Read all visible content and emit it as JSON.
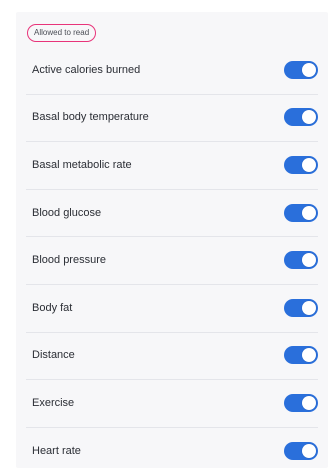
{
  "section": {
    "label": "Allowed to read"
  },
  "colors": {
    "accent": "#2a6fdb",
    "highlight_outline": "#e8347a",
    "panel_background": "#f7f7f9"
  },
  "permissions": [
    {
      "label": "Active calories burned",
      "enabled": true
    },
    {
      "label": "Basal body temperature",
      "enabled": true
    },
    {
      "label": "Basal metabolic rate",
      "enabled": true
    },
    {
      "label": "Blood glucose",
      "enabled": true
    },
    {
      "label": "Blood pressure",
      "enabled": true
    },
    {
      "label": "Body fat",
      "enabled": true
    },
    {
      "label": "Distance",
      "enabled": true
    },
    {
      "label": "Exercise",
      "enabled": true
    },
    {
      "label": "Heart rate",
      "enabled": true
    }
  ]
}
